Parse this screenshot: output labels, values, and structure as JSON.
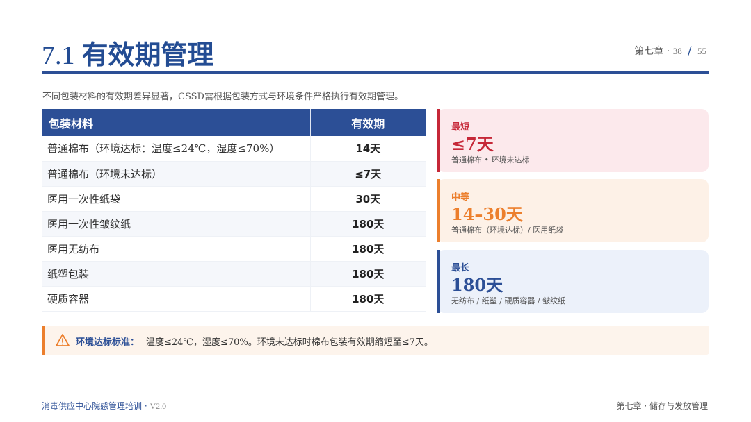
{
  "header": {
    "section_number": "7.1",
    "title": "有效期管理",
    "chapter": "第七章 ·",
    "page": "38",
    "page_sep": "/",
    "total_pages": "55"
  },
  "intro": "不同包装材料的有效期差异显著，CSSD需根据包装方式与环境条件严格执行有效期管理。",
  "table": {
    "headers": [
      "包装材料",
      "有效期"
    ],
    "rows": [
      {
        "material": "普通棉布（环境达标：温度≤24℃，湿度≤70%）",
        "validity": "14天"
      },
      {
        "material": "普通棉布（环境未达标）",
        "validity": "≤7天"
      },
      {
        "material": "医用一次性纸袋",
        "validity": "30天"
      },
      {
        "material": "医用一次性皱纹纸",
        "validity": "180天"
      },
      {
        "material": "医用无纺布",
        "validity": "180天"
      },
      {
        "material": "纸塑包装",
        "validity": "180天"
      },
      {
        "material": "硬质容器",
        "validity": "180天"
      }
    ]
  },
  "cards": [
    {
      "label": "最短",
      "value": "≤7天",
      "desc": "普通棉布 • 环境未达标",
      "color": "#c62838"
    },
    {
      "label": "中等",
      "value": "14–30天",
      "desc": "普通棉布（环境达标）/ 医用纸袋",
      "color": "#ec7f2d"
    },
    {
      "label": "最长",
      "value": "180天",
      "desc": "无纺布 / 纸塑 / 硬质容器 / 皱纹纸",
      "color": "#2c4f96"
    }
  ],
  "note": {
    "icon": "warning-triangle-icon",
    "label": "环境达标标准：",
    "text": "温度≤24℃，湿度≤70%。环境未达标时棉布包装有效期缩短至≤7天。"
  },
  "footer": {
    "left": "消毒供应中心院感管理培训 ·",
    "version": "V2.0",
    "right": "第七章 · 储存与发放管理"
  },
  "colors": {
    "primary": "#2c4f96",
    "danger": "#c62838",
    "warning": "#ec7f2d"
  }
}
